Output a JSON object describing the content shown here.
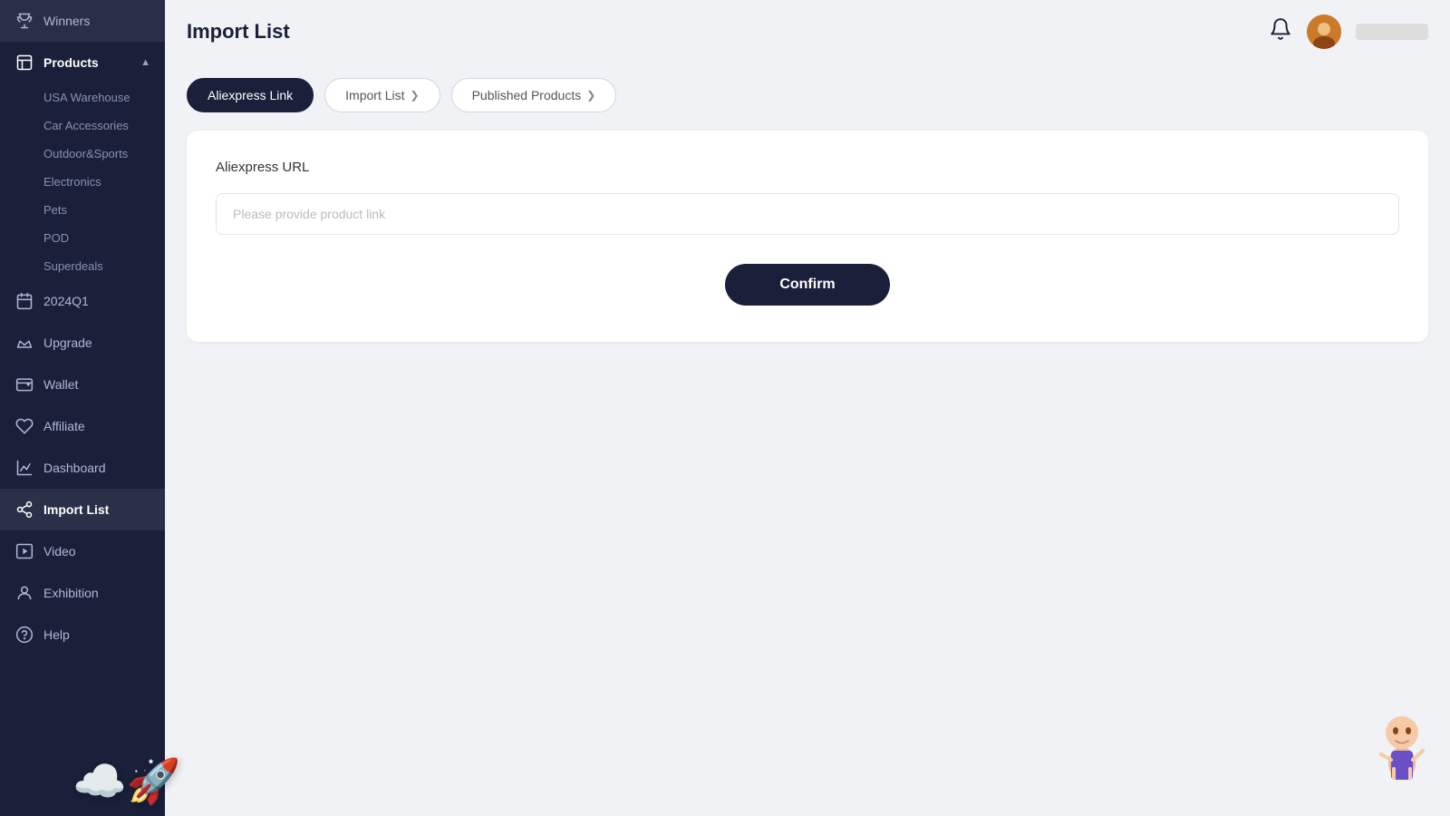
{
  "sidebar": {
    "items": [
      {
        "id": "winners",
        "label": "Winners",
        "icon": "trophy"
      },
      {
        "id": "products",
        "label": "Products",
        "icon": "box",
        "expanded": true
      },
      {
        "id": "2024q1",
        "label": "2024Q1",
        "icon": "calendar"
      },
      {
        "id": "upgrade",
        "label": "Upgrade",
        "icon": "crown"
      },
      {
        "id": "wallet",
        "label": "Wallet",
        "icon": "wallet"
      },
      {
        "id": "affiliate",
        "label": "Affiliate",
        "icon": "heart"
      },
      {
        "id": "dashboard",
        "label": "Dashboard",
        "icon": "chart"
      },
      {
        "id": "import-list",
        "label": "Import List",
        "icon": "share",
        "active": true
      },
      {
        "id": "video",
        "label": "Video",
        "icon": "play"
      },
      {
        "id": "exhibition",
        "label": "Exhibition",
        "icon": "person"
      },
      {
        "id": "help",
        "label": "Help",
        "icon": "question"
      }
    ],
    "sub_items": [
      "USA Warehouse",
      "Car Accessories",
      "Outdoor&Sports",
      "Electronics",
      "Pets",
      "POD",
      "Superdeals"
    ]
  },
  "header": {
    "title": "Import List"
  },
  "tabs": [
    {
      "id": "aliexpress-link",
      "label": "Aliexpress Link",
      "active": true,
      "chevron": ""
    },
    {
      "id": "import-list",
      "label": "Import  List",
      "active": false,
      "chevron": "❯"
    },
    {
      "id": "published-products",
      "label": "Published Products",
      "active": false,
      "chevron": "❯"
    }
  ],
  "form": {
    "section_label": "Aliexpress URL",
    "input_placeholder": "Please provide product link",
    "confirm_button": "Confirm"
  }
}
